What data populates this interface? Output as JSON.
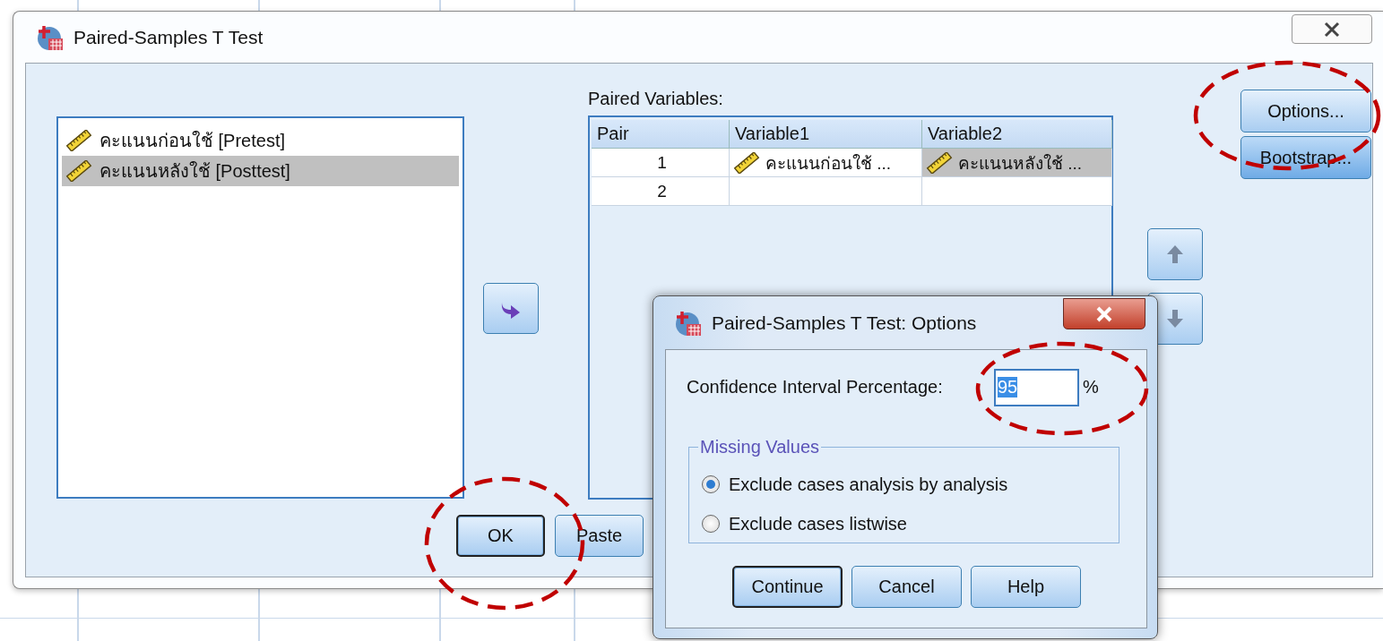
{
  "main_window": {
    "title": "Paired-Samples T Test",
    "variables": [
      {
        "label": "คะแนนก่อนใช้ [Pretest]",
        "selected": false
      },
      {
        "label": "คะแนนหลังใช้ [Posttest]",
        "selected": true
      }
    ],
    "paired_variables": {
      "label": "Paired Variables:",
      "columns": [
        "Pair",
        "Variable1",
        "Variable2"
      ],
      "rows": [
        {
          "pair": "1",
          "variable1": {
            "text": "คะแนนก่อนใช้ ...",
            "selected": false
          },
          "variable2": {
            "text": "คะแนนหลังใช้ ...",
            "selected": true
          }
        },
        {
          "pair": "2"
        }
      ]
    },
    "side_buttons": [
      {
        "label": "Options..."
      },
      {
        "label": "Bootstrap..."
      }
    ],
    "buttons": [
      {
        "label": "OK",
        "default": true
      },
      {
        "label": "Paste",
        "default": false
      }
    ]
  },
  "options_dialog": {
    "title": "Paired-Samples T Test: Options",
    "confidence": {
      "label": "Confidence Interval Percentage:",
      "value": "95",
      "unit": "%"
    },
    "missing_values": {
      "title": "Missing Values",
      "options": [
        {
          "label": "Exclude cases analysis by analysis",
          "selected": true
        },
        {
          "label": "Exclude cases listwise",
          "selected": false
        }
      ]
    },
    "buttons": [
      {
        "label": "Continue",
        "default": true
      },
      {
        "label": "Cancel",
        "default": false
      },
      {
        "label": "Help",
        "default": false
      }
    ]
  }
}
